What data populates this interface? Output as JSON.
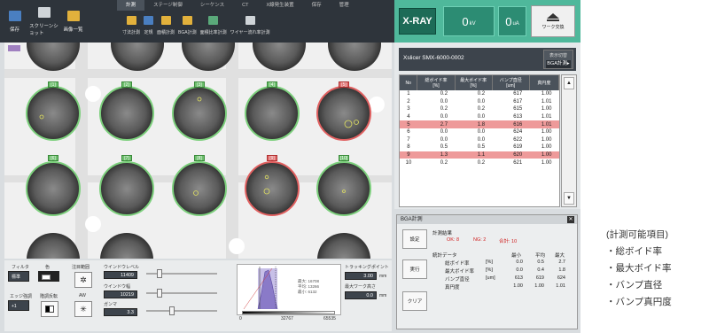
{
  "toolbar": {
    "left_buttons": [
      {
        "label": "保存",
        "icon": "save-icon",
        "color": "#4a7fc1"
      },
      {
        "label": "スクリーンショット",
        "icon": "screenshot-icon",
        "color": "#cfd4d8"
      },
      {
        "label": "画像一覧",
        "icon": "folder-icon",
        "color": "#e2b13c"
      }
    ],
    "tabs": [
      "計測",
      "ステージ制御",
      "シーケンス",
      "CT",
      "X線発生装置",
      "保存",
      "管理"
    ],
    "tools": [
      {
        "label": "寸法計測",
        "icon": "dimension-icon",
        "color": "#e2b13c"
      },
      {
        "label": "定規",
        "icon": "ruler-icon",
        "color": "#4a7fc1"
      },
      {
        "label": "面積計測",
        "icon": "area-icon",
        "color": "#e2b13c"
      },
      {
        "label": "BGA計測",
        "icon": "bga-icon",
        "color": "#e2b13c"
      },
      {
        "label": "面積比率計測",
        "icon": "area-ratio-icon",
        "color": "#5aa97a"
      },
      {
        "label": "ワイヤー流れ率計測",
        "icon": "wire-sweep-icon",
        "color": "#cfd4d8"
      }
    ]
  },
  "xray": {
    "button_label": "X-RAY",
    "kv_value": "0",
    "kv_unit": "kV",
    "ua_value": "0",
    "ua_unit": "uA",
    "work_swap_label": "ワーク交換"
  },
  "device": {
    "name": "Xslicer SMX-6000-0002",
    "display_title": "表示切替",
    "display_value": "BGA計測▸"
  },
  "results_table": {
    "headers": [
      "No",
      "総ボイド率\n[%]",
      "最大ボイド率\n[%]",
      "バンプ直径\n[um]",
      "真円度"
    ],
    "rows": [
      [
        "1",
        "0.2",
        "0.2",
        "617",
        "1.00"
      ],
      [
        "2",
        "0.0",
        "0.0",
        "617",
        "1.01"
      ],
      [
        "3",
        "0.2",
        "0.2",
        "615",
        "1.00"
      ],
      [
        "4",
        "0.0",
        "0.0",
        "613",
        "1.01"
      ],
      [
        "5",
        "2.7",
        "1.8",
        "616",
        "1.01"
      ],
      [
        "6",
        "0.0",
        "0.0",
        "624",
        "1.00"
      ],
      [
        "7",
        "0.0",
        "0.0",
        "622",
        "1.00"
      ],
      [
        "8",
        "0.5",
        "0.5",
        "619",
        "1.00"
      ],
      [
        "9",
        "1.3",
        "1.1",
        "620",
        "1.00"
      ],
      [
        "10",
        "0.2",
        "0.2",
        "621",
        "1.00"
      ]
    ],
    "ng_rows": [
      4,
      8
    ]
  },
  "bga": {
    "title": "BGA計測",
    "buttons": [
      "設定",
      "実行",
      "クリア"
    ],
    "result_title": "計測結果",
    "ok": "OK: 8",
    "ng": "NG: 2",
    "total": "合計: 10",
    "stats_title": "統計データ",
    "stats_headers": [
      "最小",
      "平均",
      "最大"
    ],
    "stats_rows": [
      {
        "name": "総ボイド率",
        "unit": "[%]",
        "min": "0.0",
        "avg": "0.5",
        "max": "2.7"
      },
      {
        "name": "最大ボイド率",
        "unit": "[%]",
        "min": "0.0",
        "avg": "0.4",
        "max": "1.8"
      },
      {
        "name": "バンプ直径",
        "unit": "[um]",
        "min": "613",
        "avg": "619",
        "max": "624"
      },
      {
        "name": "真円度",
        "unit": "",
        "min": "1.00",
        "avg": "1.00",
        "max": "1.01"
      }
    ]
  },
  "viewer": {
    "bump_labels": [
      "[1]",
      "[2]",
      "[3]",
      "[4]",
      "[5]",
      "[6]",
      "[7]",
      "[8]",
      "[9]",
      "[10]"
    ],
    "ok_color": "#6dbf6d",
    "ng_color": "#e07070"
  },
  "controls": {
    "filter_label": "フィルタ",
    "filter_value": "標準",
    "color_label": "色",
    "edge_label": "エッジ強調",
    "edge_value": "+1",
    "invert_label": "階調反転",
    "noise_label": "注目範囲",
    "auto_label": "AW",
    "window_level_label": "ウインドウレベル",
    "window_level_value": "11409",
    "window_width_label": "ウインドウ幅",
    "window_width_value": "10219",
    "gamma_label": "ガンマ",
    "gamma_value": "3.3",
    "histo_min": "0",
    "histo_mid": "32767",
    "histo_max": "65535",
    "histo_stat_max": "最大: 16708",
    "histo_stat_avg": "平均: 13266",
    "histo_stat_min": "最小: 6132",
    "tracking_label": "トラッキングポイント",
    "tracking_value": "3.00",
    "tracking_unit": "mm",
    "max_work_label": "最大ワーク高さ",
    "max_work_value": "0.0",
    "max_work_unit": "mm"
  },
  "note": {
    "title": "(計測可能項目)",
    "items": [
      "・総ボイド率",
      "・最大ボイド率",
      "・バンプ直径",
      "・バンプ真円度"
    ]
  }
}
